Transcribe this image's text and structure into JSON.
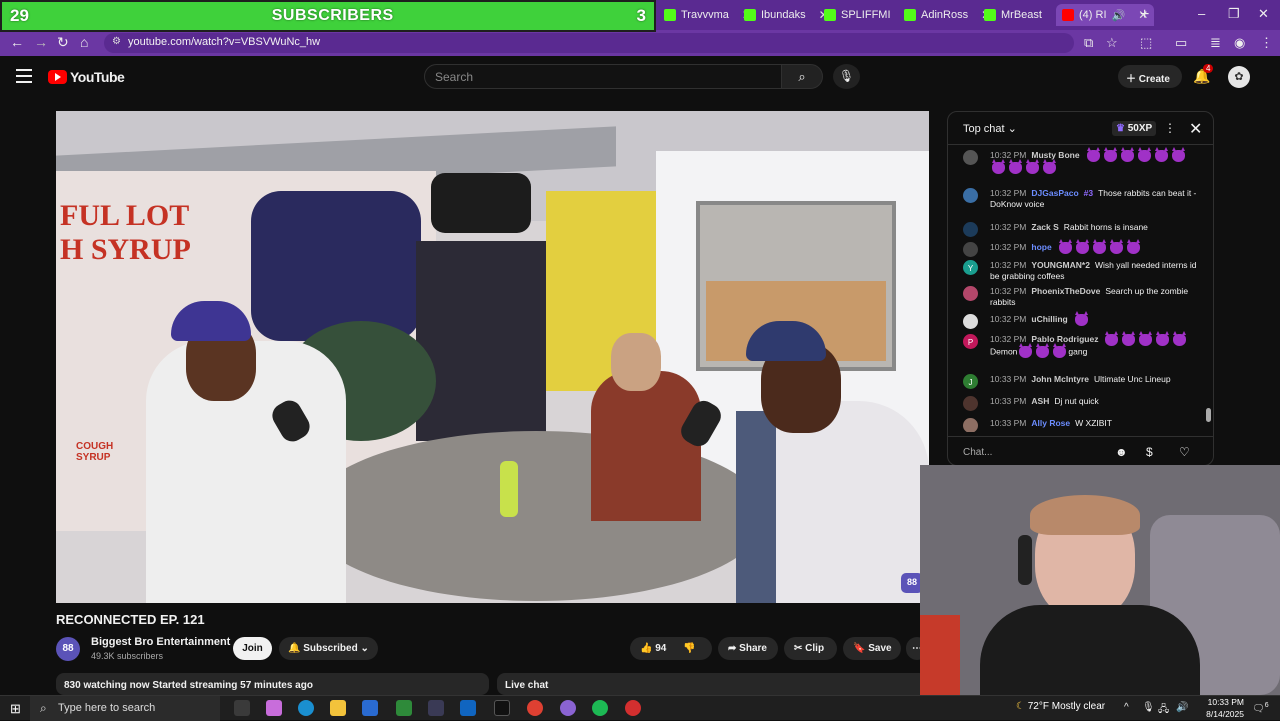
{
  "overlay": {
    "left_count": "29",
    "label": "SUBSCRIBERS",
    "right_count": "3"
  },
  "browser": {
    "tabs": [
      {
        "label": "Travvvma",
        "color": "#53fc18"
      },
      {
        "label": "Ibundaks",
        "color": "#53fc18"
      },
      {
        "label": "SPLIFFMI",
        "color": "#53fc18"
      },
      {
        "label": "AdinRoss",
        "color": "#53fc18"
      },
      {
        "label": "MrBeast",
        "color": "#53fc18"
      },
      {
        "label": "(4) RI",
        "color": "#ff0000"
      }
    ],
    "url": "youtube.com/watch?v=VBSVWuNc_hw"
  },
  "youtube": {
    "logo": "YouTube",
    "search_placeholder": "Search",
    "create_label": "Create",
    "notif_count": "4"
  },
  "video": {
    "title": "RECONNECTED EP. 121",
    "channel": "Biggest Bro Entertainment",
    "subscribers": "49.3K subscribers",
    "join_label": "Join",
    "subscribed_label": "Subscribed",
    "likes": "94",
    "share_label": "Share",
    "clip_label": "Clip",
    "save_label": "Save",
    "stats": "830 watching now  Started streaming 57 minutes ago",
    "live_chat_label": "Live chat",
    "wall_text_1": "FUL LOT",
    "wall_text_2": "H SYRUP",
    "wall_text_3": "COUGH SYRUP"
  },
  "chat": {
    "header": "Top chat",
    "xp": "50XP",
    "input_placeholder": "Chat...",
    "messages": [
      {
        "time": "10:32 PM",
        "author": "Musty Bone",
        "text": "",
        "emotes": 10,
        "avatar_color": "#555"
      },
      {
        "time": "10:32 PM",
        "author": "DJGasPaco",
        "badge": "#3",
        "text": "Those rabbits can beat it - DoKnow voice",
        "emotes": 0,
        "blue": true,
        "avatar_color": "#3a6ea5"
      },
      {
        "time": "10:32 PM",
        "author": "Zack S",
        "text": "Rabbit horns is insane",
        "emotes": 0,
        "avatar_color": "#1c3b5a"
      },
      {
        "time": "10:32 PM",
        "author": "hope",
        "text": "",
        "emotes": 5,
        "blue": true,
        "avatar_color": "#444"
      },
      {
        "time": "10:32 PM",
        "author": "YOUNGMAN*2",
        "text": "Wish yall needed interns id be grabbing coffees",
        "emotes": 0,
        "avatar_color": "#1a9e8f",
        "initial": "Y"
      },
      {
        "time": "10:32 PM",
        "author": "PhoenixTheDove",
        "text": "Search up the zombie rabbits",
        "emotes": 0,
        "avatar_color": "#b3476a"
      },
      {
        "time": "10:32 PM",
        "author": "uChilling",
        "text": "",
        "emotes": 1,
        "avatar_color": "#ddd"
      },
      {
        "time": "10:32 PM",
        "author": "Pablo Rodriguez",
        "text": "Demon",
        "tail": "gang",
        "emotes": 8,
        "avatar_color": "#c2185b",
        "initial": "P"
      },
      {
        "time": "10:33 PM",
        "author": "John McIntyre",
        "text": "Ultimate Unc Lineup",
        "emotes": 0,
        "avatar_color": "#2e7d32",
        "initial": "J"
      },
      {
        "time": "10:33 PM",
        "author": "ASH",
        "text": "Dj nut quick",
        "emotes": 0,
        "avatar_color": "#4e342e"
      },
      {
        "time": "10:33 PM",
        "author": "Ally Rose",
        "text": "W XZIBIT",
        "emotes": 0,
        "blue": true,
        "avatar_color": "#8d6e63"
      }
    ]
  },
  "taskbar": {
    "search_placeholder": "Type here to search",
    "weather": "72°F  Mostly clear",
    "time": "10:33 PM",
    "date": "8/14/2025",
    "notif": "6"
  }
}
